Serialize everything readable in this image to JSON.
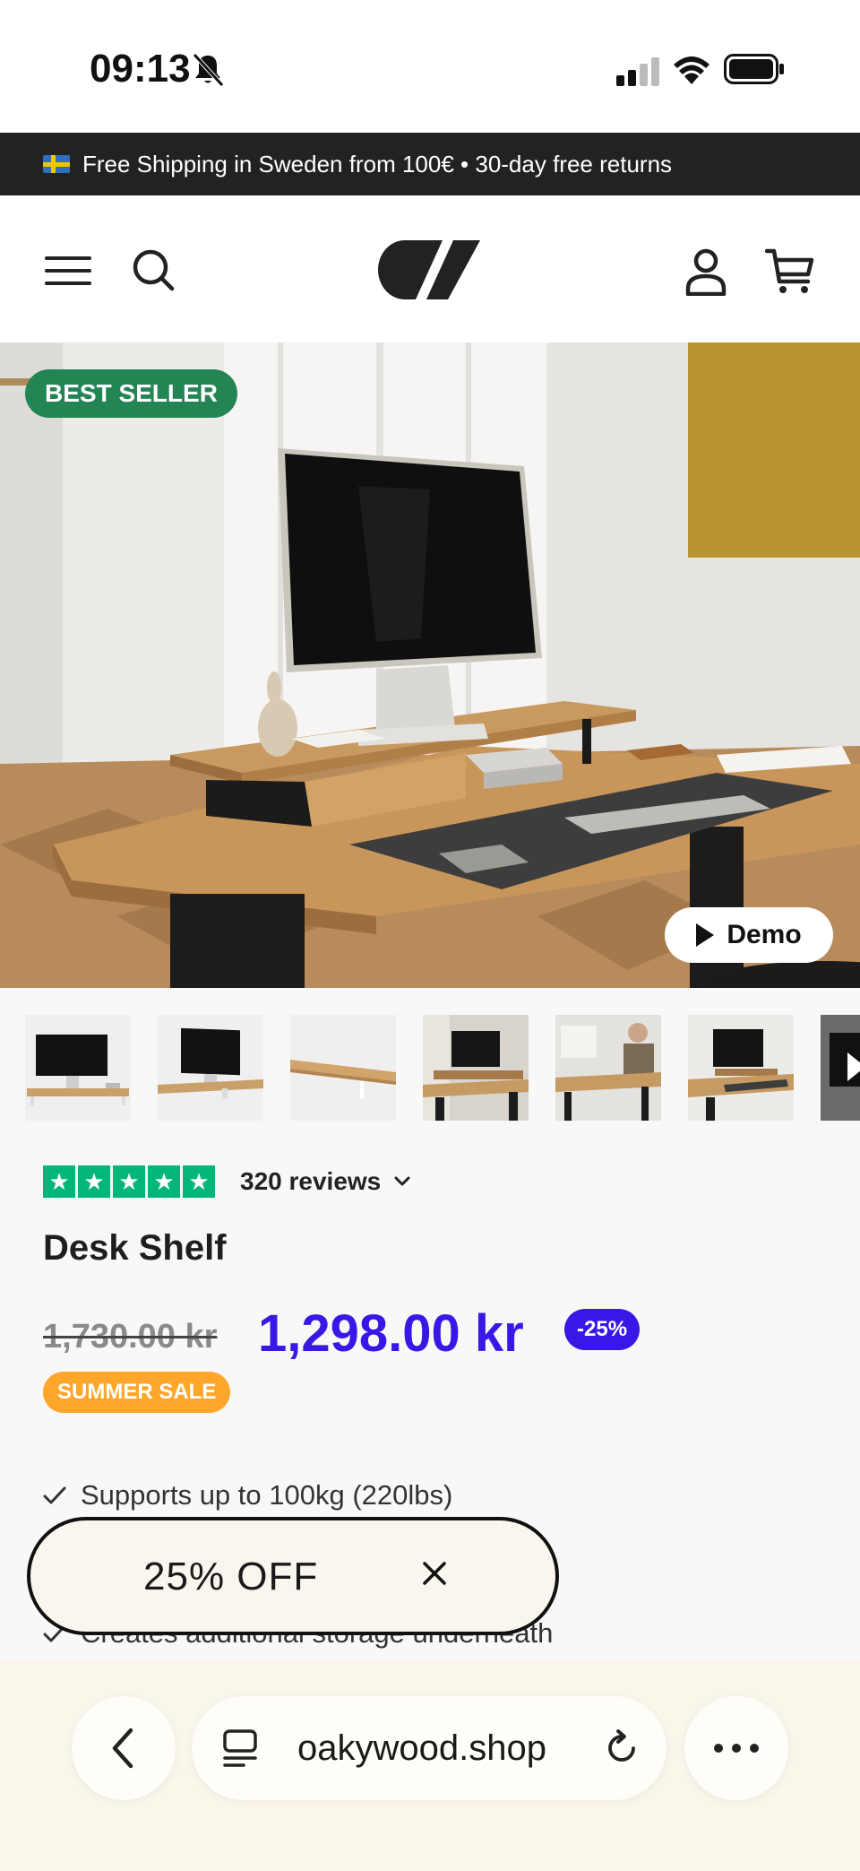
{
  "status_bar": {
    "time": "09:13"
  },
  "promo": {
    "text": "Free Shipping in Sweden from 100€ • 30-day free returns"
  },
  "hero": {
    "badge": "BEST SELLER",
    "demo_label": "Demo"
  },
  "product": {
    "rating_stars": 5,
    "reviews": "320 reviews",
    "title": "Desk Shelf",
    "old_price": "1,730.00 kr",
    "price": "1,298.00 kr",
    "discount": "-25%",
    "sale_tag": "SUMMER SALE",
    "features": [
      "Supports up to 100kg (220lbs)",
      "Creates additional storage underneath"
    ]
  },
  "popup": {
    "text": "25% OFF"
  },
  "browser": {
    "url": "oakywood.shop"
  },
  "colors": {
    "accent": "#3a17e6",
    "best_seller": "#238454",
    "sale": "#ffa62b",
    "trustpilot": "#00b67a"
  }
}
